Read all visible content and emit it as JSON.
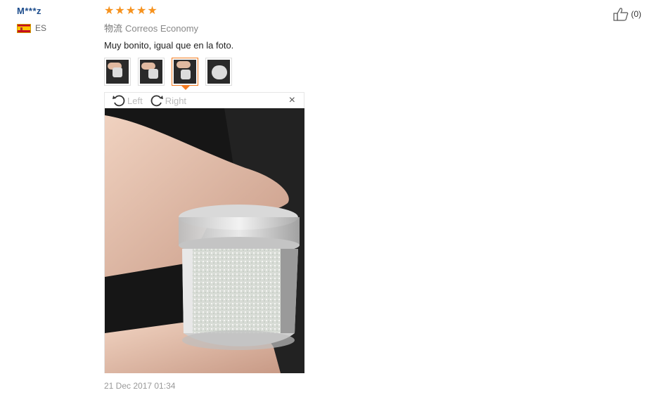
{
  "user": {
    "name": "M***z",
    "country_code": "ES"
  },
  "review": {
    "rating": 5,
    "max_rating": 5,
    "shipping_label": "物流",
    "shipping_method": "Correos Economy",
    "comment": "Muy bonito, igual que en la foto.",
    "date": "21 Dec 2017 01:34",
    "helpful_count": "(0)",
    "thumbnails_count": 4,
    "active_thumbnail": 3
  },
  "viewer": {
    "rotate_left": "Left",
    "rotate_right": "Right",
    "close": "×"
  },
  "colors": {
    "star": "#f6921e",
    "active_border": "#f47b20",
    "username": "#1c4c8c"
  },
  "icons": {
    "rotate_left": "rotate-left-icon",
    "rotate_right": "rotate-right-icon",
    "thumbs_up": "thumbs-up-icon",
    "close": "close-icon",
    "flag": "flag-spain-icon"
  }
}
